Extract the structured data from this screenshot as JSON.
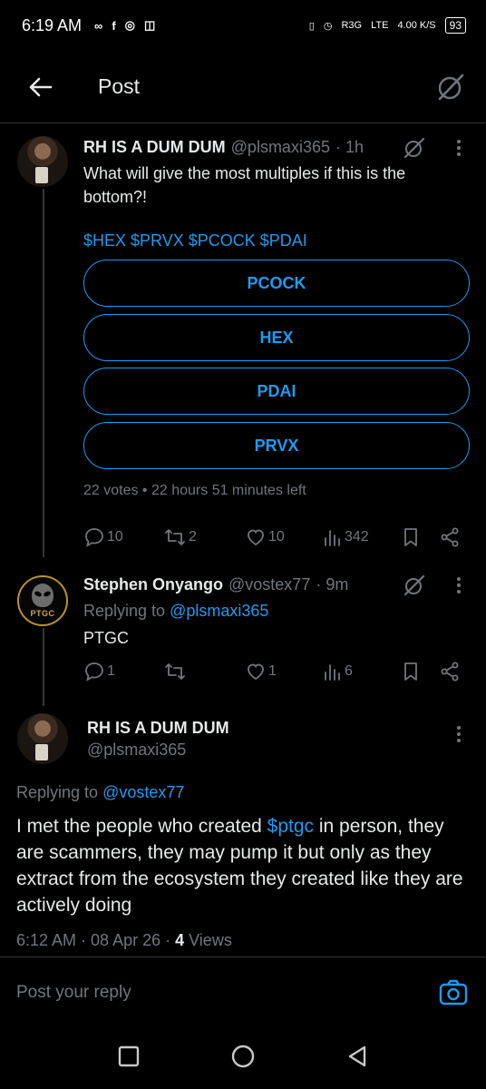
{
  "status_bar": {
    "time": "6:19 AM",
    "apps": [
      "∞",
      "f",
      "◎",
      "◫"
    ],
    "network": "R3G",
    "lte": "LTE",
    "speed": "4.00 K/S",
    "battery": "93"
  },
  "header": {
    "title": "Post"
  },
  "posts": {
    "poll_post": {
      "author_name": "RH IS A DUM DUM",
      "author_handle": "@plsmaxi365",
      "time_ago": "· 1h",
      "text": "What will give the most multiples if this is the bottom?!",
      "tickers": "$HEX $PRVX $PCOCK $PDAI",
      "poll_options": [
        "PCOCK",
        "HEX",
        "PDAI",
        "PRVX"
      ],
      "poll_meta": "22 votes • 22 hours 51 minutes left",
      "stats": {
        "replies": "10",
        "reposts": "2",
        "likes": "10",
        "views": "342"
      }
    },
    "reply_post": {
      "author_name": "Stephen Onyango",
      "author_handle": "@vostex77",
      "time_ago": "· 9m",
      "replying_prefix": "Replying to",
      "replying_to": "@plsmaxi365",
      "text": "PTGC",
      "avatar_label": "PTGC",
      "stats": {
        "replies": "1",
        "reposts": "",
        "likes": "1",
        "views": "6"
      }
    },
    "main_post": {
      "author_name": "RH IS A DUM DUM",
      "author_handle": "@plsmaxi365",
      "replying_prefix": "Replying to",
      "replying_to": "@vostex77",
      "text_before": "I met the people who created ",
      "text_link": "$ptgc",
      "text_after": " in person, they are scammers, they may pump it but only as they extract from the ecosystem they created like they are actively doing",
      "timestamp": "6:12 AM · 08 Apr 26 · ",
      "views_count": "4",
      "views_label": " Views"
    }
  },
  "reply_bar": {
    "placeholder": "Post your reply"
  },
  "colors": {
    "accent": "#1d9bf0",
    "muted": "#71767b",
    "background": "#000000",
    "text": "#e7e9ea"
  }
}
